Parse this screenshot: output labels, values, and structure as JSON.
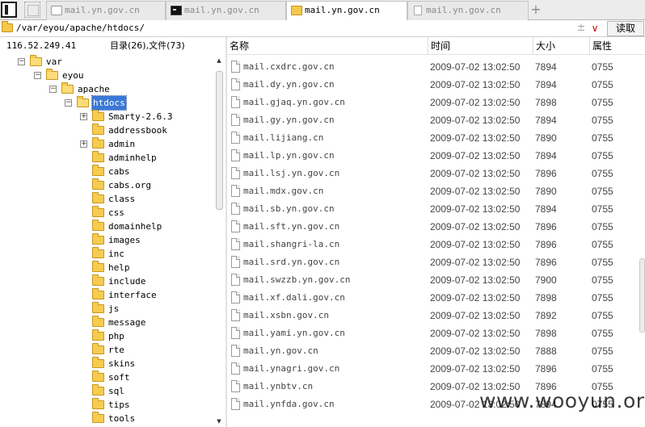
{
  "tabs": [
    {
      "label": "mail.yn.gov.cn",
      "icon": "page-icon"
    },
    {
      "label": "mail.yn.gov.cn",
      "icon": "terminal-icon"
    },
    {
      "label": "mail.yn.gov.cn",
      "icon": "folder-icon",
      "active": true
    },
    {
      "label": "mail.yn.gov.cn",
      "icon": "document-icon"
    }
  ],
  "tab_add_label": "+",
  "address": {
    "path": "/var/eyou/apache/htdocs/",
    "pin_glyph": "±",
    "dropdown_glyph": "∨",
    "read_button": "读取"
  },
  "left": {
    "ip": "116.52.249.41",
    "counts": "目录(26),文件(73)",
    "tree": [
      {
        "label": "var",
        "level": 0,
        "expander": "−"
      },
      {
        "label": "eyou",
        "level": 1,
        "expander": "−"
      },
      {
        "label": "apache",
        "level": 2,
        "expander": "−"
      },
      {
        "label": "htdocs",
        "level": 3,
        "expander": "−",
        "selected": true
      },
      {
        "label": "Smarty-2.6.3",
        "level": 4,
        "expander": "+"
      },
      {
        "label": "addressbook",
        "level": 4
      },
      {
        "label": "admin",
        "level": 4,
        "expander": "+"
      },
      {
        "label": "adminhelp",
        "level": 4
      },
      {
        "label": "cabs",
        "level": 4
      },
      {
        "label": "cabs.org",
        "level": 4
      },
      {
        "label": "class",
        "level": 4
      },
      {
        "label": "css",
        "level": 4
      },
      {
        "label": "domainhelp",
        "level": 4
      },
      {
        "label": "images",
        "level": 4
      },
      {
        "label": "inc",
        "level": 4
      },
      {
        "label": "help",
        "level": 4
      },
      {
        "label": "include",
        "level": 4
      },
      {
        "label": "interface",
        "level": 4
      },
      {
        "label": "js",
        "level": 4
      },
      {
        "label": "message",
        "level": 4
      },
      {
        "label": "php",
        "level": 4
      },
      {
        "label": "rte",
        "level": 4
      },
      {
        "label": "skins",
        "level": 4
      },
      {
        "label": "soft",
        "level": 4
      },
      {
        "label": "sql",
        "level": 4
      },
      {
        "label": "tips",
        "level": 4
      },
      {
        "label": "tools",
        "level": 4
      }
    ]
  },
  "columns": {
    "name": "名称",
    "time": "时间",
    "size": "大小",
    "attr": "属性"
  },
  "files": [
    {
      "name": "mail.cxdrc.gov.cn",
      "time": "2009-07-02 13:02:50",
      "size": "7894",
      "attr": "0755"
    },
    {
      "name": "mail.dy.yn.gov.cn",
      "time": "2009-07-02 13:02:50",
      "size": "7894",
      "attr": "0755"
    },
    {
      "name": "mail.gjaq.yn.gov.cn",
      "time": "2009-07-02 13:02:50",
      "size": "7898",
      "attr": "0755"
    },
    {
      "name": "mail.gy.yn.gov.cn",
      "time": "2009-07-02 13:02:50",
      "size": "7894",
      "attr": "0755"
    },
    {
      "name": "mail.lijiang.cn",
      "time": "2009-07-02 13:02:50",
      "size": "7890",
      "attr": "0755"
    },
    {
      "name": "mail.lp.yn.gov.cn",
      "time": "2009-07-02 13:02:50",
      "size": "7894",
      "attr": "0755"
    },
    {
      "name": "mail.lsj.yn.gov.cn",
      "time": "2009-07-02 13:02:50",
      "size": "7896",
      "attr": "0755"
    },
    {
      "name": "mail.mdx.gov.cn",
      "time": "2009-07-02 13:02:50",
      "size": "7890",
      "attr": "0755"
    },
    {
      "name": "mail.sb.yn.gov.cn",
      "time": "2009-07-02 13:02:50",
      "size": "7894",
      "attr": "0755"
    },
    {
      "name": "mail.sft.yn.gov.cn",
      "time": "2009-07-02 13:02:50",
      "size": "7896",
      "attr": "0755"
    },
    {
      "name": "mail.shangri-la.cn",
      "time": "2009-07-02 13:02:50",
      "size": "7896",
      "attr": "0755"
    },
    {
      "name": "mail.srd.yn.gov.cn",
      "time": "2009-07-02 13:02:50",
      "size": "7896",
      "attr": "0755"
    },
    {
      "name": "mail.swzzb.yn.gov.cn",
      "time": "2009-07-02 13:02:50",
      "size": "7900",
      "attr": "0755"
    },
    {
      "name": "mail.xf.dali.gov.cn",
      "time": "2009-07-02 13:02:50",
      "size": "7898",
      "attr": "0755"
    },
    {
      "name": "mail.xsbn.gov.cn",
      "time": "2009-07-02 13:02:50",
      "size": "7892",
      "attr": "0755"
    },
    {
      "name": "mail.yami.yn.gov.cn",
      "time": "2009-07-02 13:02:50",
      "size": "7898",
      "attr": "0755"
    },
    {
      "name": "mail.yn.gov.cn",
      "time": "2009-07-02 13:02:50",
      "size": "7888",
      "attr": "0755"
    },
    {
      "name": "mail.ynagri.gov.cn",
      "time": "2009-07-02 13:02:50",
      "size": "7896",
      "attr": "0755"
    },
    {
      "name": "mail.ynbtv.cn",
      "time": "2009-07-02 13:02:50",
      "size": "7896",
      "attr": "0755"
    },
    {
      "name": "mail.ynfda.gov.cn",
      "time": "2009-07-02 13:02:50",
      "size": "7894",
      "attr": "0755"
    }
  ],
  "watermark": "www.wooyun.org"
}
